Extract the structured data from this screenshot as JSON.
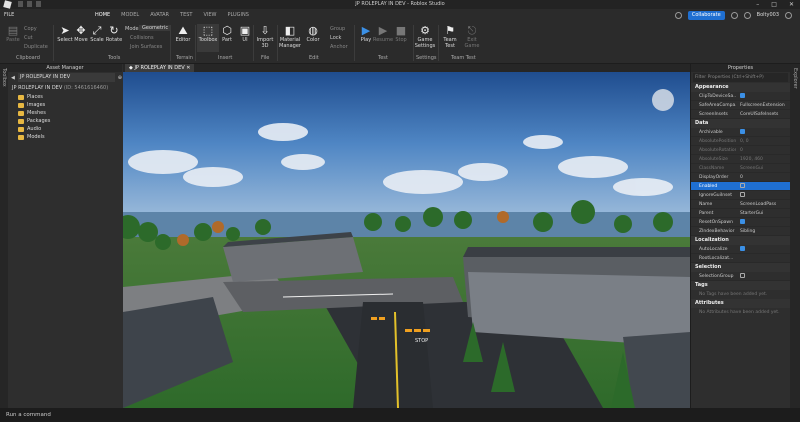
{
  "window": {
    "title": "JP ROLEPLAY IN DEV - Roblox Studio"
  },
  "menubar": {
    "file": "FILE",
    "tabs": [
      "HOME",
      "MODEL",
      "AVATAR",
      "TEST",
      "VIEW",
      "PLUGINS"
    ],
    "active_tab": "HOME",
    "collaborate": "Collaborate",
    "user": "Bolty003"
  },
  "ribbon": {
    "clipboard": {
      "paste": "Paste",
      "copy": "Copy",
      "cut": "Cut",
      "duplicate": "Duplicate",
      "label": "Clipboard"
    },
    "tools": {
      "select": "Select",
      "move": "Move",
      "scale": "Scale",
      "rotate": "Rotate",
      "label": "Tools",
      "mode_label": "Mode:",
      "mode_value": "Geometric",
      "collisions": "Collisions",
      "join_surfaces": "Join Surfaces"
    },
    "terrain": {
      "editor": "Editor",
      "label": "Terrain"
    },
    "insert": {
      "toolbox": "Toolbox",
      "part": "Part",
      "ui": "UI",
      "label": "Insert"
    },
    "file": {
      "import3d": "Import 3D",
      "label": "File"
    },
    "edit": {
      "material_manager": "Material Manager",
      "color": "Color",
      "group": "Group",
      "lock": "Lock",
      "anchor": "Anchor",
      "label": "Edit"
    },
    "test": {
      "play": "Play",
      "resume": "Resume",
      "stop": "Stop",
      "label": "Test"
    },
    "settings": {
      "game_settings": "Game Settings",
      "label": "Settings"
    },
    "team_test": {
      "team_test": "Team Test",
      "exit_game": "Exit Game",
      "label": "Team Test"
    }
  },
  "explorer": {
    "header": "Asset Manager",
    "asset_row": "JP ROLEPLAY IN DEV",
    "place_title": "JP ROLEPLAY IN DEV",
    "place_id": "(ID: 5461616460)",
    "items": [
      "Places",
      "Images",
      "Meshes",
      "Packages",
      "Audio",
      "Models"
    ]
  },
  "side_labels": {
    "left": "Toolbox",
    "right": "Explorer"
  },
  "viewport": {
    "tab": "JP ROLEPLAY IN DEV",
    "road_label": "STOP"
  },
  "properties": {
    "header": "Properties",
    "filter": "Filter Properties (Ctrl+Shift+P)",
    "sections": [
      {
        "name": "Appearance",
        "rows": [
          {
            "k": "ClipToDeviceSa...",
            "v": "",
            "check": true
          },
          {
            "k": "SafeAreaCompa...",
            "v": "FullscreenExtension"
          },
          {
            "k": "ScreenInsets",
            "v": "CoreUISafeInsets"
          }
        ]
      },
      {
        "name": "Data",
        "rows": [
          {
            "k": "Archivable",
            "v": "",
            "check": true
          },
          {
            "k": "AbsolutePosition",
            "v": "0, 0",
            "dim": true
          },
          {
            "k": "AbsoluteRotation",
            "v": "0",
            "dim": true
          },
          {
            "k": "AbsoluteSize",
            "v": "1920, 460",
            "dim": true
          },
          {
            "k": "ClassName",
            "v": "ScreenGui",
            "dim": true
          },
          {
            "k": "DisplayOrder",
            "v": "0"
          },
          {
            "k": "Enabled",
            "v": "",
            "checkOff": true,
            "selected": true
          },
          {
            "k": "IgnoreGuiInset",
            "v": "",
            "checkOff": true
          },
          {
            "k": "Name",
            "v": "ScreenLoadPass"
          },
          {
            "k": "Parent",
            "v": "StarterGui"
          },
          {
            "k": "ResetOnSpawn",
            "v": "",
            "check": true
          },
          {
            "k": "ZIndexBehavior",
            "v": "Sibling"
          }
        ]
      },
      {
        "name": "Localization",
        "rows": [
          {
            "k": "AutoLocalize",
            "v": "",
            "check": true
          },
          {
            "k": "RootLocalizat...",
            "v": ""
          }
        ]
      },
      {
        "name": "Selection",
        "rows": [
          {
            "k": "SelectionGroup",
            "v": "",
            "checkOff": true
          }
        ]
      },
      {
        "name": "Tags",
        "note": "No Tags have been added yet."
      },
      {
        "name": "Attributes",
        "note": "No Attributes have been added yet."
      }
    ]
  },
  "command_bar": {
    "placeholder": "Run a command"
  }
}
